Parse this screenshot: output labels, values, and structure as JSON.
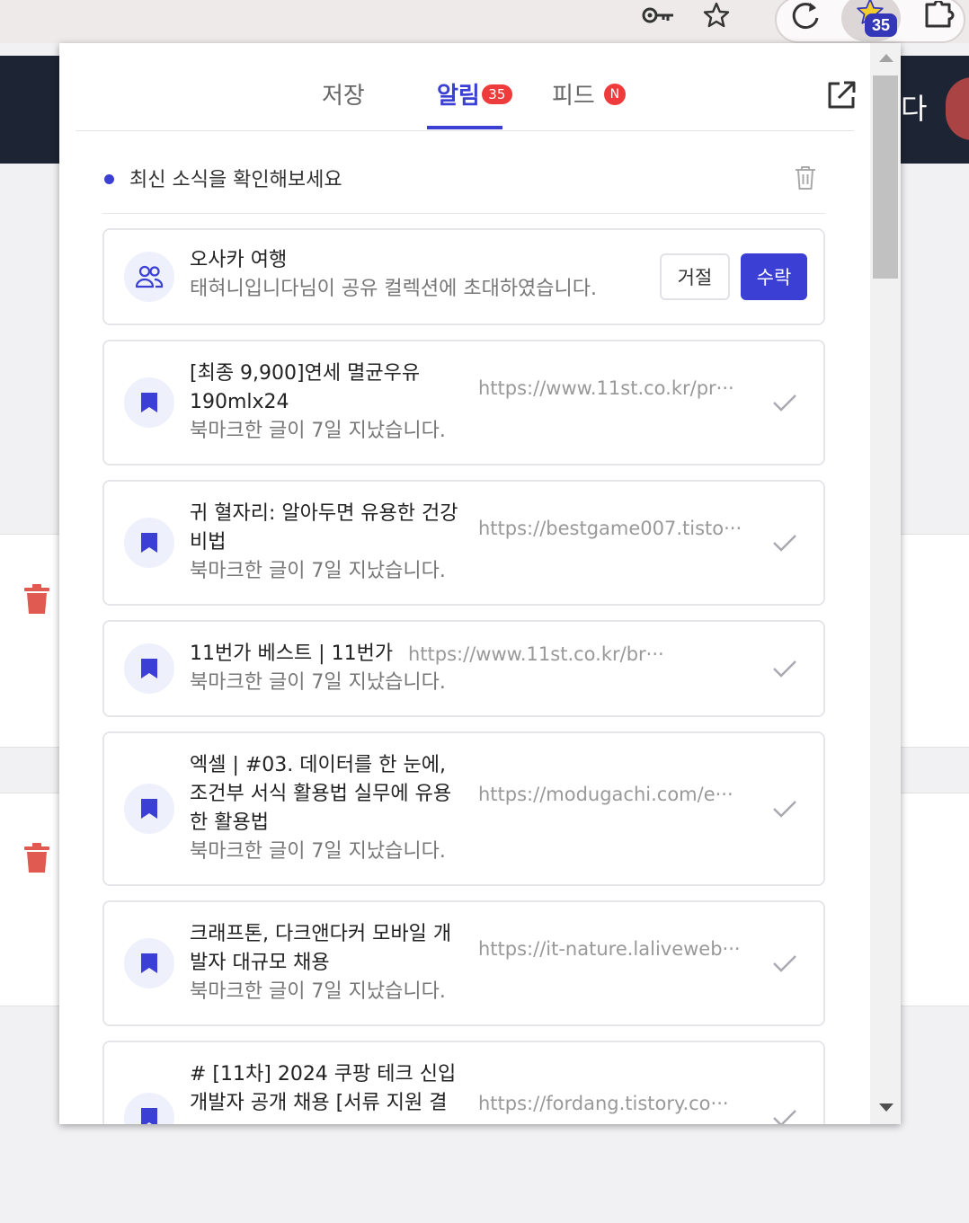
{
  "browser": {
    "extension_badge": "35"
  },
  "background": {
    "header_text": "다"
  },
  "popup": {
    "tabs": [
      {
        "label": "저장"
      },
      {
        "label": "알림",
        "badge": "35"
      },
      {
        "label": "피드",
        "badge": "N"
      }
    ],
    "news": "최신 소식을 확인해보세요",
    "invite": {
      "title": "오사카 여행",
      "subtitle": "태혀니입니다님이 공유 컬렉션에 초대하였습니다.",
      "reject_label": "거절",
      "accept_label": "수락"
    },
    "notifications": [
      {
        "title_lines": [
          "[최종 9,900]연세 멸균우유",
          "190mlx24"
        ],
        "url": "https://www.11st.co.kr/pr···",
        "subtitle": "북마크한 글이 7일 지났습니다."
      },
      {
        "title_lines": [
          "귀 혈자리: 알아두면 유용한 건강",
          "비법"
        ],
        "url": "https://bestgame007.tisto···",
        "subtitle": "북마크한 글이 7일 지났습니다."
      },
      {
        "title_lines": [
          "11번가 베스트 | 11번가"
        ],
        "url": "https://www.11st.co.kr/br···",
        "subtitle": "북마크한 글이 7일 지났습니다."
      },
      {
        "title_lines": [
          "엑셀  | #03. 데이터를 한 눈에,",
          "조건부 서식 활용법 실무에 유용",
          "한 활용법"
        ],
        "url": "https://modugachi.com/e···",
        "subtitle": "북마크한 글이 7일 지났습니다."
      },
      {
        "title_lines": [
          "크래프톤, 다크앤다커 모바일 개",
          "발자 대규모 채용"
        ],
        "url": "https://it-nature.laliveweb···",
        "subtitle": "북마크한 글이 7일 지났습니다."
      },
      {
        "title_lines": [
          "# [11차] 2024 쿠팡 테크 신입",
          "개발자 공개 채용 [서류 지원 결"
        ],
        "url": "https://fordang.tistory.co···",
        "subtitle": ""
      }
    ]
  },
  "colors": {
    "accent": "#3b3fd4",
    "badge_red": "#ee3b3b",
    "trash_red": "#e05a52"
  }
}
